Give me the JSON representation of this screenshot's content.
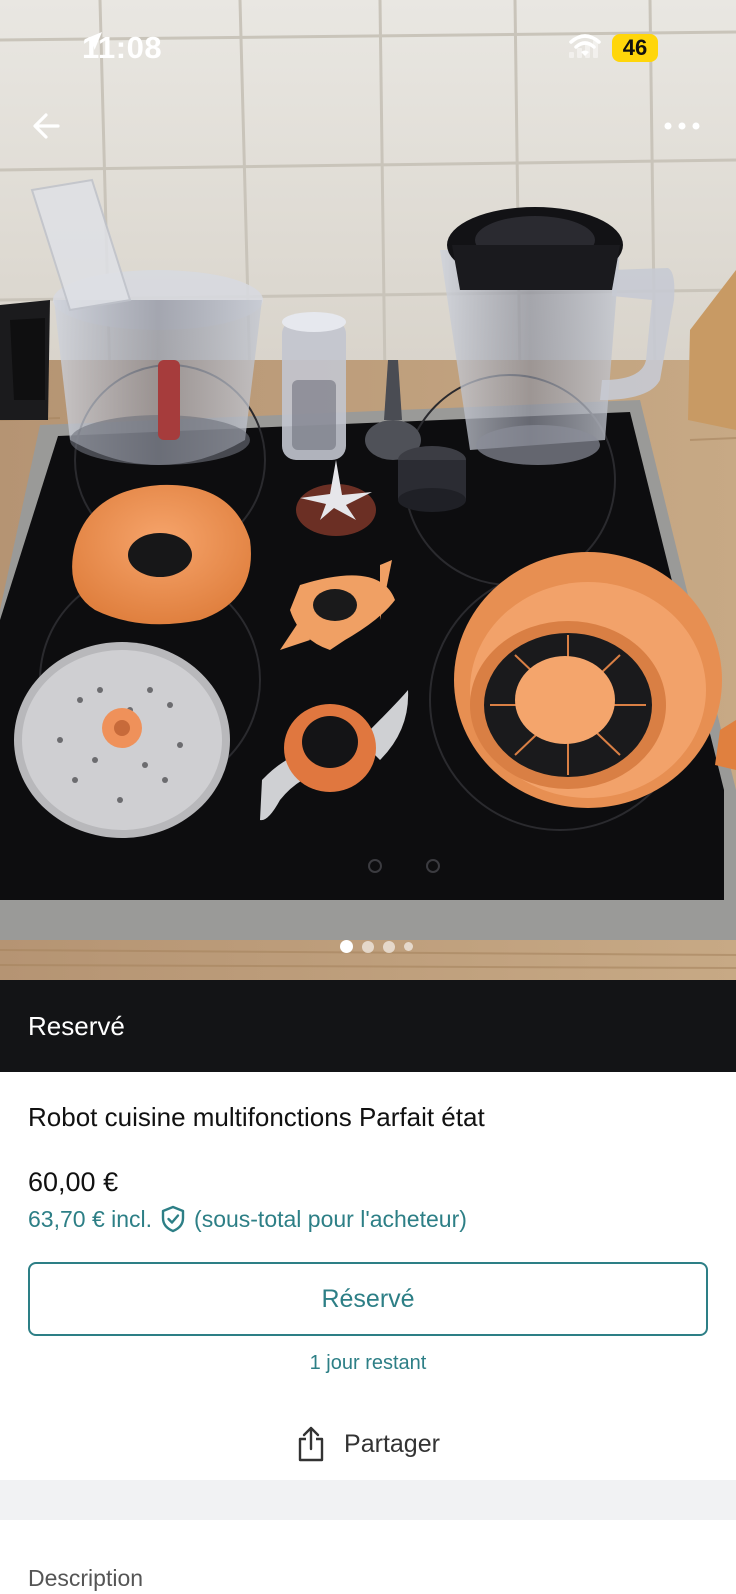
{
  "status_bar": {
    "time": "11:08",
    "battery": "46"
  },
  "icons": {
    "location": "location-arrow-icon",
    "wifi": "wifi-icon",
    "signal": "cellular-signal-icon",
    "back": "arrow-left-icon",
    "more": "ellipsis-icon",
    "shield": "shield-check-icon",
    "share": "share-icon"
  },
  "gallery": {
    "image_count": 4,
    "current_index": 1
  },
  "banner": {
    "label": "Reservé"
  },
  "item": {
    "title": "Robot cuisine multifonctions Parfait état",
    "price": "60,00 €",
    "price_incl": "63,70 € incl.",
    "price_note": "(sous-total pour l'acheteur)"
  },
  "actions": {
    "reserved_button": "Réservé",
    "remaining": "1 jour restant",
    "share": "Partager"
  },
  "section": {
    "description_label": "Description"
  },
  "colors": {
    "accent": "#2d7f86",
    "banner_bg": "#131416",
    "battery": "#ffd60a"
  }
}
